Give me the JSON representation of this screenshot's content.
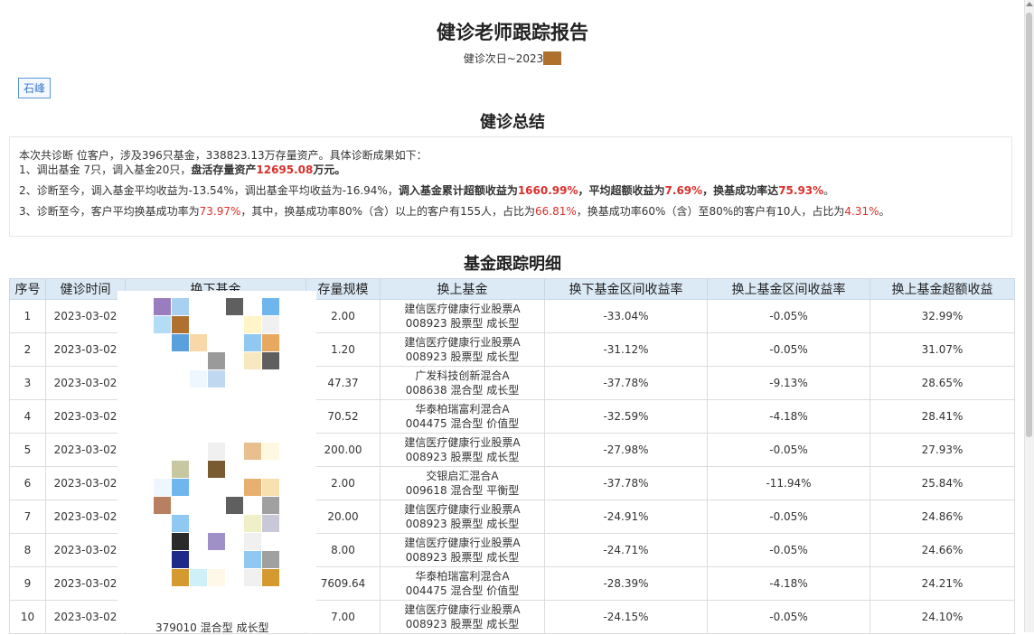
{
  "header": {
    "title": "健诊老师跟踪报告",
    "subtitle": "健诊次日~2023"
  },
  "teacher_tag": "石峰",
  "summary": {
    "title": "健诊总结",
    "line0": "本次共诊断   位客户，涉及396只基金，338823.13万存量资产。具体诊断成果如下：",
    "line1_a": "1、调出基金  7只，调入基金20只，",
    "line1_b": "盘活存量资产",
    "line1_c": "12695.08",
    "line1_d": "万元。",
    "line2_a": "2、诊断至今，调入基金平均收益为-13.54%，调出基金平均收益为-16.94%，",
    "line2_b": "调入基金累计超额收益为",
    "line2_c": "1660.99%",
    "line2_d": "，平均超额收益为",
    "line2_e": "7.69%",
    "line2_f": "，换基成功率达",
    "line2_g": "75.93%",
    "line2_h": "。",
    "line3_a": "3、诊断至今，客户平均换基成功率为",
    "line3_b": "73.97%",
    "line3_c": "，其中，换基成功率80%（含）以上的客户有155人，占比为",
    "line3_d": "66.81%",
    "line3_e": "，换基成功率60%（含）至80%的客户有10人，占比为",
    "line3_f": "4.31%",
    "line3_g": "。"
  },
  "detail": {
    "title": "基金跟踪明细",
    "columns": [
      "序号",
      "健诊时间",
      "换下基金",
      "存量规模",
      "换上基金",
      "换下基金区间收益率",
      "换上基金区间收益率",
      "换上基金超额收益"
    ],
    "rows": [
      {
        "no": "1",
        "date": "2023-03-02",
        "scale": "2.00",
        "fund_name": "建信医疗健康行业股票A",
        "fund_code": "008923 股票型 成长型",
        "down_return": "-33.04%",
        "up_return": "-0.05%",
        "excess": "32.99%"
      },
      {
        "no": "2",
        "date": "2023-03-02",
        "scale": "1.20",
        "fund_name": "建信医疗健康行业股票A",
        "fund_code": "008923 股票型 成长型",
        "down_return": "-31.12%",
        "up_return": "-0.05%",
        "excess": "31.07%"
      },
      {
        "no": "3",
        "date": "2023-03-02",
        "scale": "47.37",
        "fund_name": "广发科技创新混合A",
        "fund_code": "008638 混合型 成长型",
        "down_return": "-37.78%",
        "up_return": "-9.13%",
        "excess": "28.65%"
      },
      {
        "no": "4",
        "date": "2023-03-02",
        "scale": "70.52",
        "fund_name": "华泰柏瑞富利混合A",
        "fund_code": "004475 混合型 价值型",
        "down_return": "-32.59%",
        "up_return": "-4.18%",
        "excess": "28.41%"
      },
      {
        "no": "5",
        "date": "2023-03-02",
        "scale": "200.00",
        "fund_name": "建信医疗健康行业股票A",
        "fund_code": "008923 股票型 成长型",
        "down_return": "-27.98%",
        "up_return": "-0.05%",
        "excess": "27.93%"
      },
      {
        "no": "6",
        "date": "2023-03-02",
        "scale": "2.00",
        "fund_name": "交银启汇混合A",
        "fund_code": "009618 混合型 平衡型",
        "down_return": "-37.78%",
        "up_return": "-11.94%",
        "excess": "25.84%"
      },
      {
        "no": "7",
        "date": "2023-03-02",
        "scale": "20.00",
        "fund_name": "建信医疗健康行业股票A",
        "fund_code": "008923 股票型 成长型",
        "down_return": "-24.91%",
        "up_return": "-0.05%",
        "excess": "24.86%"
      },
      {
        "no": "8",
        "date": "2023-03-02",
        "scale": "8.00",
        "fund_name": "建信医疗健康行业股票A",
        "fund_code": "008923 股票型 成长型",
        "down_return": "-24.71%",
        "up_return": "-0.05%",
        "excess": "24.66%"
      },
      {
        "no": "9",
        "date": "2023-03-02",
        "scale": "7609.64",
        "fund_name": "华泰柏瑞富利混合A",
        "fund_code": "004475 混合型 价值型",
        "down_return": "-28.39%",
        "up_return": "-4.18%",
        "excess": "24.21%"
      },
      {
        "no": "10",
        "date": "2023-03-02",
        "scale": "7.00",
        "fund_name": "建信医疗健康行业股票A",
        "fund_code": "008923 股票型 成长型",
        "down_return": "-24.15%",
        "up_return": "-0.05%",
        "excess": "24.10%"
      }
    ],
    "mosaic_tail": "379010 混合型 成长型"
  },
  "colors": {
    "accent_blue": "#3b78c9",
    "header_bg": "#dceaf6",
    "positive_red": "#d9302b",
    "negative_green": "#19a14a",
    "redaction_brown": "#b0702d"
  }
}
